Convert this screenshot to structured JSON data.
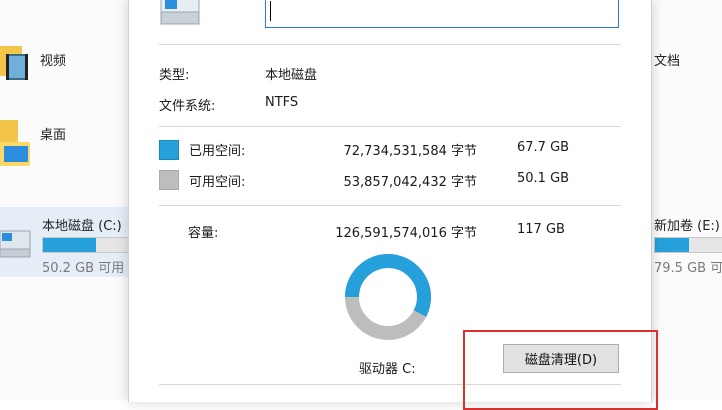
{
  "explorer": {
    "folders": [
      {
        "label": "视频",
        "icon": "video-folder-icon"
      },
      {
        "label": "桌面",
        "icon": "desktop-folder-icon"
      },
      {
        "label": "文档",
        "icon": "documents-folder-icon"
      }
    ],
    "drives": [
      {
        "label": "本地磁盘 (C:)",
        "free_text": "50.2 GB 可用",
        "used_fraction": 0.6,
        "icon": "local-disk-icon",
        "selected": true
      },
      {
        "label": "新加卷 (E:)",
        "free_text": "79.5 GB 可用",
        "used_fraction": 0.5,
        "icon": "volume-disk-icon",
        "selected": false
      }
    ]
  },
  "dialog": {
    "drive_icon": "drive-icon",
    "name_value": "",
    "type_label": "类型:",
    "type_value": "本地磁盘",
    "fs_label": "文件系统:",
    "fs_value": "NTFS",
    "used": {
      "label": "已用空间:",
      "bytes": "72,734,531,584 字节",
      "gb": "67.7 GB",
      "color": "#26a0da"
    },
    "free": {
      "label": "可用空间:",
      "bytes": "53,857,042,432 字节",
      "gb": "50.1 GB",
      "color": "#bdbdbd"
    },
    "capacity": {
      "label": "容量:",
      "bytes": "126,591,574,016 字节",
      "gb": "117 GB"
    },
    "used_fraction": 0.575,
    "drive_caption": "驱动器 C:",
    "cleanup_button": "磁盘清理(D)"
  },
  "colors": {
    "accent": "#26a0da",
    "annotation": "#d9322e"
  }
}
